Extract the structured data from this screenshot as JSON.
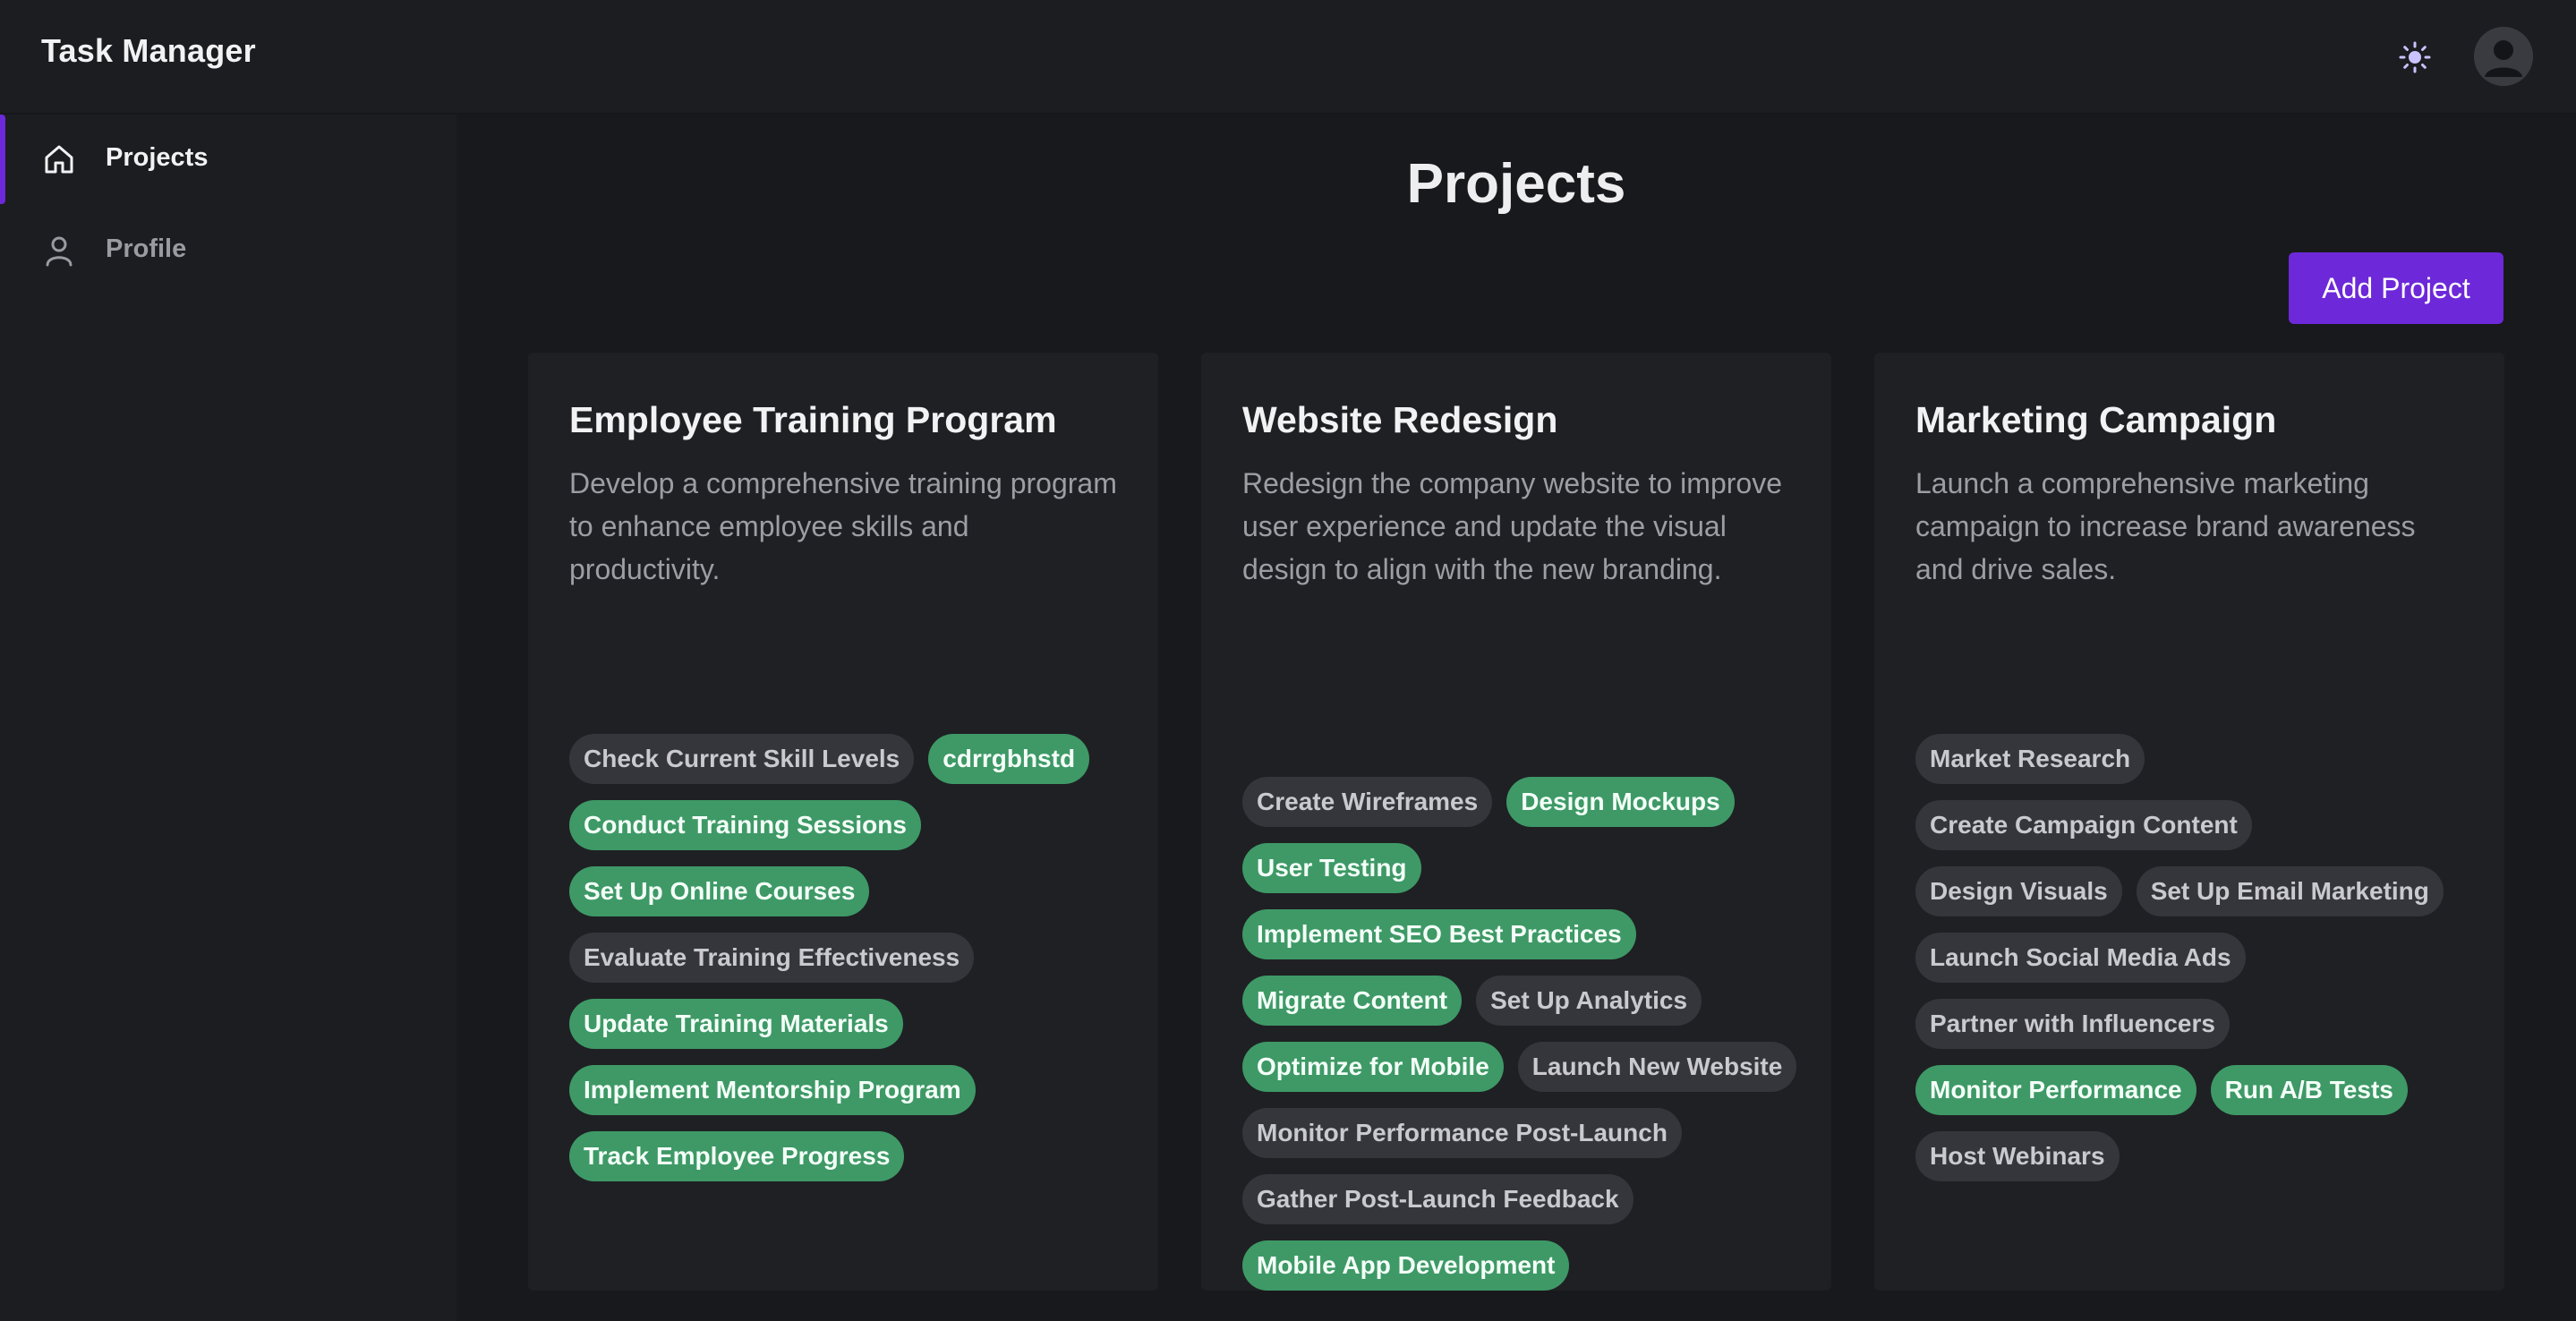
{
  "app": {
    "title": "Task Manager"
  },
  "header": {
    "theme_icon": "sun-icon",
    "avatar_icon": "user-avatar-icon"
  },
  "colors": {
    "accent": "#6d28d9",
    "done_tag": "#3e9966",
    "todo_tag": "#35363b"
  },
  "sidebar": {
    "items": [
      {
        "label": "Projects",
        "icon": "home-icon",
        "active": true
      },
      {
        "label": "Profile",
        "icon": "user-icon",
        "active": false
      }
    ]
  },
  "main": {
    "title": "Projects",
    "add_button_label": "Add Project",
    "projects": [
      {
        "title": "Employee Training Program",
        "description": "Develop a comprehensive training program to enhance employee skills and productivity.",
        "tasks": [
          {
            "label": "Check Current Skill Levels",
            "done": false
          },
          {
            "label": "cdrrgbhstd",
            "done": true
          },
          {
            "label": "Conduct Training Sessions",
            "done": true
          },
          {
            "label": "Set Up Online Courses",
            "done": true
          },
          {
            "label": "Evaluate Training Effectiveness",
            "done": false
          },
          {
            "label": "Update Training Materials",
            "done": true
          },
          {
            "label": "Implement Mentorship Program",
            "done": true
          },
          {
            "label": "Track Employee Progress",
            "done": true
          }
        ]
      },
      {
        "title": "Website Redesign",
        "description": "Redesign the company website to improve user experience and update the visual design to align with the new branding.",
        "tasks": [
          {
            "label": "Create Wireframes",
            "done": false
          },
          {
            "label": "Design Mockups",
            "done": true
          },
          {
            "label": "User Testing",
            "done": true
          },
          {
            "label": "Implement SEO Best Practices",
            "done": true
          },
          {
            "label": "Migrate Content",
            "done": true
          },
          {
            "label": "Set Up Analytics",
            "done": false
          },
          {
            "label": "Optimize for Mobile",
            "done": true
          },
          {
            "label": "Launch New Website",
            "done": false
          },
          {
            "label": "Monitor Performance Post-Launch",
            "done": false
          },
          {
            "label": "Gather Post-Launch Feedback",
            "done": false
          },
          {
            "label": "Mobile App Development",
            "done": true
          }
        ]
      },
      {
        "title": "Marketing Campaign",
        "description": "Launch a comprehensive marketing campaign to increase brand awareness and drive sales.",
        "tasks": [
          {
            "label": "Market Research",
            "done": false
          },
          {
            "label": "Create Campaign Content",
            "done": false
          },
          {
            "label": "Design Visuals",
            "done": false
          },
          {
            "label": "Set Up Email Marketing",
            "done": false
          },
          {
            "label": "Launch Social Media Ads",
            "done": false
          },
          {
            "label": "Partner with Influencers",
            "done": false
          },
          {
            "label": "Monitor Performance",
            "done": true
          },
          {
            "label": "Run A/B Tests",
            "done": true
          },
          {
            "label": "Host Webinars",
            "done": false
          }
        ]
      }
    ]
  }
}
